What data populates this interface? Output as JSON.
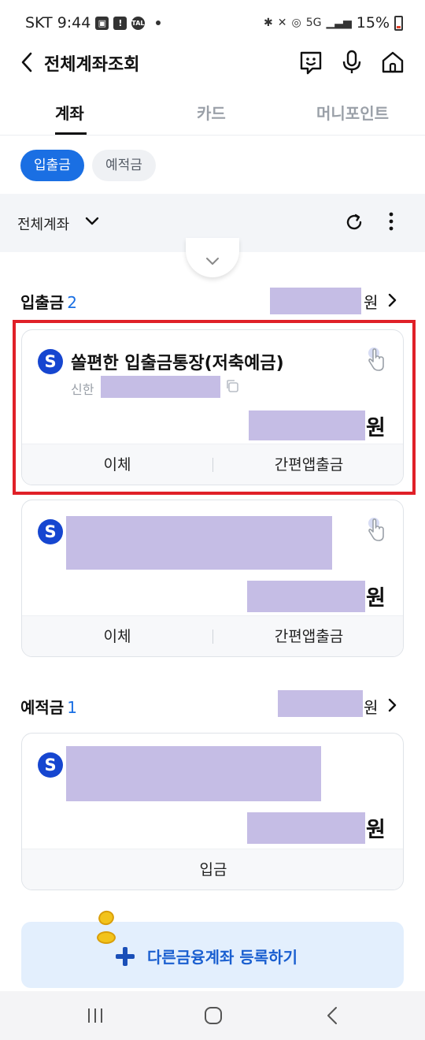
{
  "status_bar": {
    "carrier_time": "SKT 9:44",
    "network": "5G",
    "battery": "15%"
  },
  "header": {
    "title": "전체계좌조회"
  },
  "tabs": [
    {
      "label": "계좌"
    },
    {
      "label": "카드"
    },
    {
      "label": "머니포인트"
    }
  ],
  "chips": [
    {
      "label": "입출금"
    },
    {
      "label": "예적금"
    }
  ],
  "filter": {
    "label": "전체계좌"
  },
  "sections": [
    {
      "title": "입출금",
      "count": "2",
      "won": "원",
      "cards": [
        {
          "bank_logo": "S",
          "title": "쏠편한 입출금통장(저축예금)",
          "bank": "신한",
          "won": "원",
          "actions": [
            "이체",
            "간편앱출금"
          ]
        },
        {
          "bank_logo": "S",
          "won": "원",
          "actions": [
            "이체",
            "간편앱출금"
          ]
        }
      ]
    },
    {
      "title": "예적금",
      "count": "1",
      "won": "원",
      "cards": [
        {
          "bank_logo": "S",
          "won": "원",
          "actions": [
            "입금"
          ]
        }
      ]
    }
  ],
  "register_button": {
    "label": "다른금융계좌 등록하기"
  },
  "colors": {
    "accent": "#1a6fe3",
    "mask": "#c5bde5",
    "highlight": "#e02028",
    "bank": "#1646d0"
  }
}
